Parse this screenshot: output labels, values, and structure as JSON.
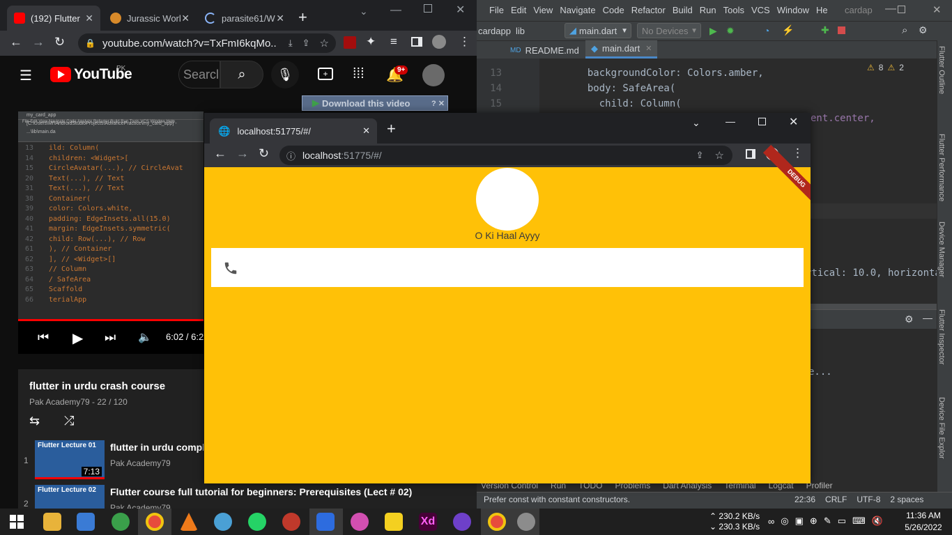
{
  "yt_browser": {
    "tabs": [
      {
        "label": "(192) Flutter "
      },
      {
        "label": "Jurassic Worl"
      },
      {
        "label": "parasite61/W"
      }
    ],
    "url": "youtube.com/watch?v=TxFmI6kqMo...",
    "search_placeholder": "Searcl",
    "logo_text": "YouTube",
    "region": "PK",
    "notifications": "9+",
    "download_banner": "Download this video",
    "video_time": "6:02 / 6:2",
    "playlist_title": "flutter in urdu crash course",
    "playlist_meta": "Pak Academy79 - 22 / 120",
    "playlist_items": [
      {
        "index": "1",
        "title": "flutter in urdu comple",
        "channel": "Pak Academy79",
        "duration": "7:13"
      },
      {
        "index": "2",
        "title": "Flutter course full tutorial for beginners: Prerequisites (Lect # 02)",
        "channel": "Pak Academy79",
        "duration": ""
      }
    ],
    "thumb_1_text": "Flutter Lecture 01",
    "thumb_2_text": "Flutter Lecture 02"
  },
  "ide_in_video": {
    "lines": [
      {
        "no": "13",
        "code": "ild: Column("
      },
      {
        "no": "14",
        "code": "children: <Widget>["
      },
      {
        "no": "15",
        "code": "CircleAvatar(...), // CircleAvat"
      },
      {
        "no": "20",
        "code": "Text(...), // Text"
      },
      {
        "no": "31",
        "code": "Text(...), // Text"
      },
      {
        "no": "38",
        "code": "Container("
      },
      {
        "no": "39",
        "code": "color: Colors.white,"
      },
      {
        "no": "40",
        "code": "padding: EdgeInsets.all(15.0)"
      },
      {
        "no": "41",
        "code": "margin: EdgeInsets.symmetric("
      },
      {
        "no": "42",
        "code": "child: Row(...), // Row"
      },
      {
        "no": "61",
        "code": "), // Container"
      },
      {
        "no": "62",
        "code": "], // <Widget>[]"
      },
      {
        "no": "63",
        "code": "// Column"
      },
      {
        "no": "64",
        "code": "/ SafeArea"
      },
      {
        "no": "65",
        "code": "Scaffold"
      },
      {
        "no": "66",
        "code": "terialApp"
      }
    ]
  },
  "ide": {
    "menu": [
      "File",
      "Edit",
      "View",
      "Navigate",
      "Code",
      "Refactor",
      "Build",
      "Run",
      "Tools",
      "VCS",
      "Window",
      "He"
    ],
    "project": "cardap",
    "breadcrumbs": [
      "cardapp",
      "lib"
    ],
    "run_config": "main.dart",
    "device": "No Devices",
    "file_tabs": [
      "README.md",
      "main.dart"
    ],
    "code_lines": [
      {
        "no": "13",
        "code": "  backgroundColor: Colors.amber,"
      },
      {
        "no": "14",
        "code": "  body: SafeArea("
      },
      {
        "no": "15",
        "code": "    child: Column("
      }
    ],
    "code_frag_1": "ent.center,",
    "code_frag_2": "rtical: 10.0, horizonta",
    "code_frag_3": "e...",
    "warnings": "8",
    "weak_warnings": "2",
    "right_panels": [
      "Flutter Outline",
      "Flutter Performance",
      "Device Manager",
      "Flutter Inspector",
      "Device File Explor"
    ],
    "bottom_tabs": [
      "Version Control",
      "Run",
      "TODO",
      "Problems",
      "Dart Analysis",
      "Terminal",
      "Logcat",
      "Profiler"
    ],
    "status_msg": "Prefer const with constant constructors.",
    "status_pos": "22:36",
    "status_crlf": "CRLF",
    "status_enc": "UTF-8",
    "status_indent": "2 spaces"
  },
  "lh_browser": {
    "tab_label": "localhost:51775/#/",
    "url_host": "localhost",
    "url_rest": ":51775/#/",
    "debug_label": "DEBUG",
    "name_text": "O Ki Haal Ayyy"
  },
  "taskbar": {
    "net_up": "230.2 KB/s",
    "net_down": "230.3 KB/s",
    "time": "11:36 AM",
    "date": "5/26/2022"
  }
}
